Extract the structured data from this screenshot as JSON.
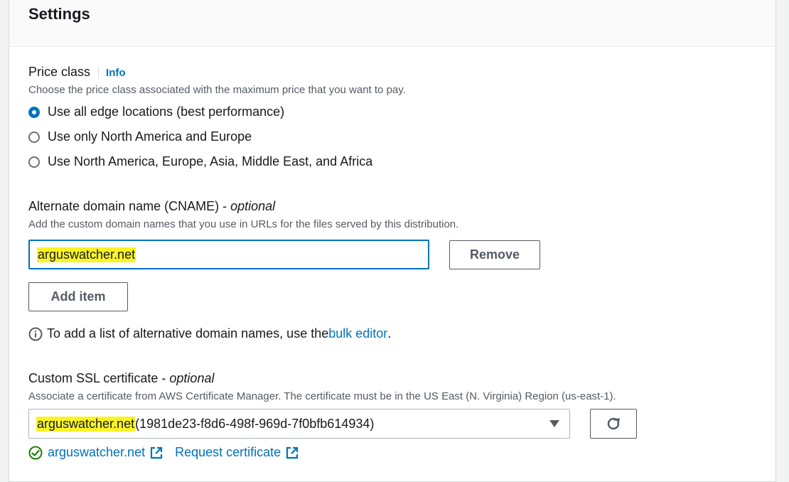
{
  "settings": {
    "title": "Settings"
  },
  "price_class": {
    "label": "Price class",
    "info_link": "Info",
    "description": "Choose the price class associated with the maximum price that you want to pay.",
    "options": [
      {
        "label": "Use all edge locations (best performance)",
        "selected": true
      },
      {
        "label": "Use only North America and Europe",
        "selected": false
      },
      {
        "label": "Use North America, Europe, Asia, Middle East, and Africa",
        "selected": false
      }
    ]
  },
  "cname": {
    "label": "Alternate domain name (CNAME) - ",
    "label_optional": "optional",
    "description": "Add the custom domain names that you use in URLs for the files served by this distribution.",
    "value": "arguswatcher.net",
    "remove_label": "Remove",
    "add_item_label": "Add item",
    "info_prefix": "To add a list of alternative domain names, use the ",
    "info_link": "bulk editor",
    "info_suffix": "."
  },
  "ssl": {
    "label": "Custom SSL certificate - ",
    "label_optional": "optional",
    "description": "Associate a certificate from AWS Certificate Manager. The certificate must be in the US East (N. Virginia) Region (us-east-1).",
    "selected_domain": "arguswatcher.net",
    "selected_id": " (1981de23-f8d6-498f-969d-7f0bfb614934)",
    "status_link": "arguswatcher.net",
    "request_link": "Request certificate"
  },
  "colors": {
    "accent": "#0073bb",
    "highlight": "#fbf425",
    "success": "#1d8102"
  }
}
